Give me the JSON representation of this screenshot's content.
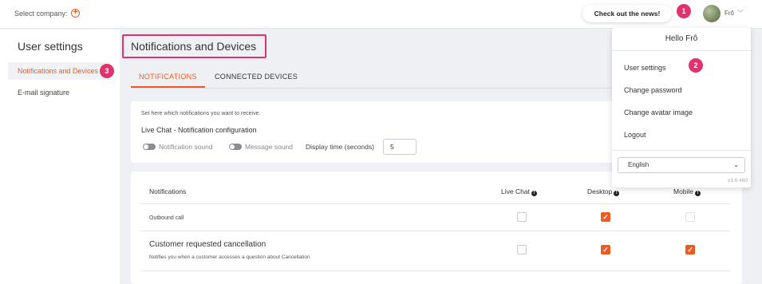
{
  "topbar": {
    "select_company_label": "Select company:",
    "news_button": "Check out the news!",
    "user_short": "Frô",
    "badge1": "1"
  },
  "sidebar": {
    "title": "User settings",
    "items": [
      {
        "label": "Notifications and Devices",
        "active": true
      },
      {
        "label": "E-mail signature",
        "active": false
      }
    ],
    "badge3": "3"
  },
  "main": {
    "page_title": "Notifications and Devices",
    "tabs": [
      {
        "label": "NOTIFICATIONS",
        "active": true
      },
      {
        "label": "CONNECTED DEVICES",
        "active": false
      }
    ],
    "hint": "Set here which notifications you want to receive.",
    "live_chat_title": "Live Chat - Notification configuration",
    "toggles": [
      {
        "label": "Notification sound",
        "on": false
      },
      {
        "label": "Message sound",
        "on": false
      }
    ],
    "display_time_label": "Display time (seconds)",
    "display_time_value": "5",
    "table": {
      "columns": [
        "Notifications",
        "Live Chat",
        "Desktop",
        "Mobile"
      ],
      "rows": [
        {
          "label": "Outbound call",
          "desc": "",
          "live_chat": false,
          "desktop": true,
          "mobile": false
        },
        {
          "label": "Customer requested cancellation",
          "desc": "Notifies you when a customer accesses a question about Cancellation",
          "live_chat": false,
          "desktop": true,
          "mobile": true
        }
      ]
    }
  },
  "dropdown": {
    "hello": "Hello Frô",
    "items": [
      "User settings",
      "Change password",
      "Change avatar image",
      "Logout"
    ],
    "badge2": "2",
    "language": "English",
    "version": "v1.6.460"
  },
  "colors": {
    "accent": "#ee5a24",
    "annotation": "#e0336d"
  }
}
